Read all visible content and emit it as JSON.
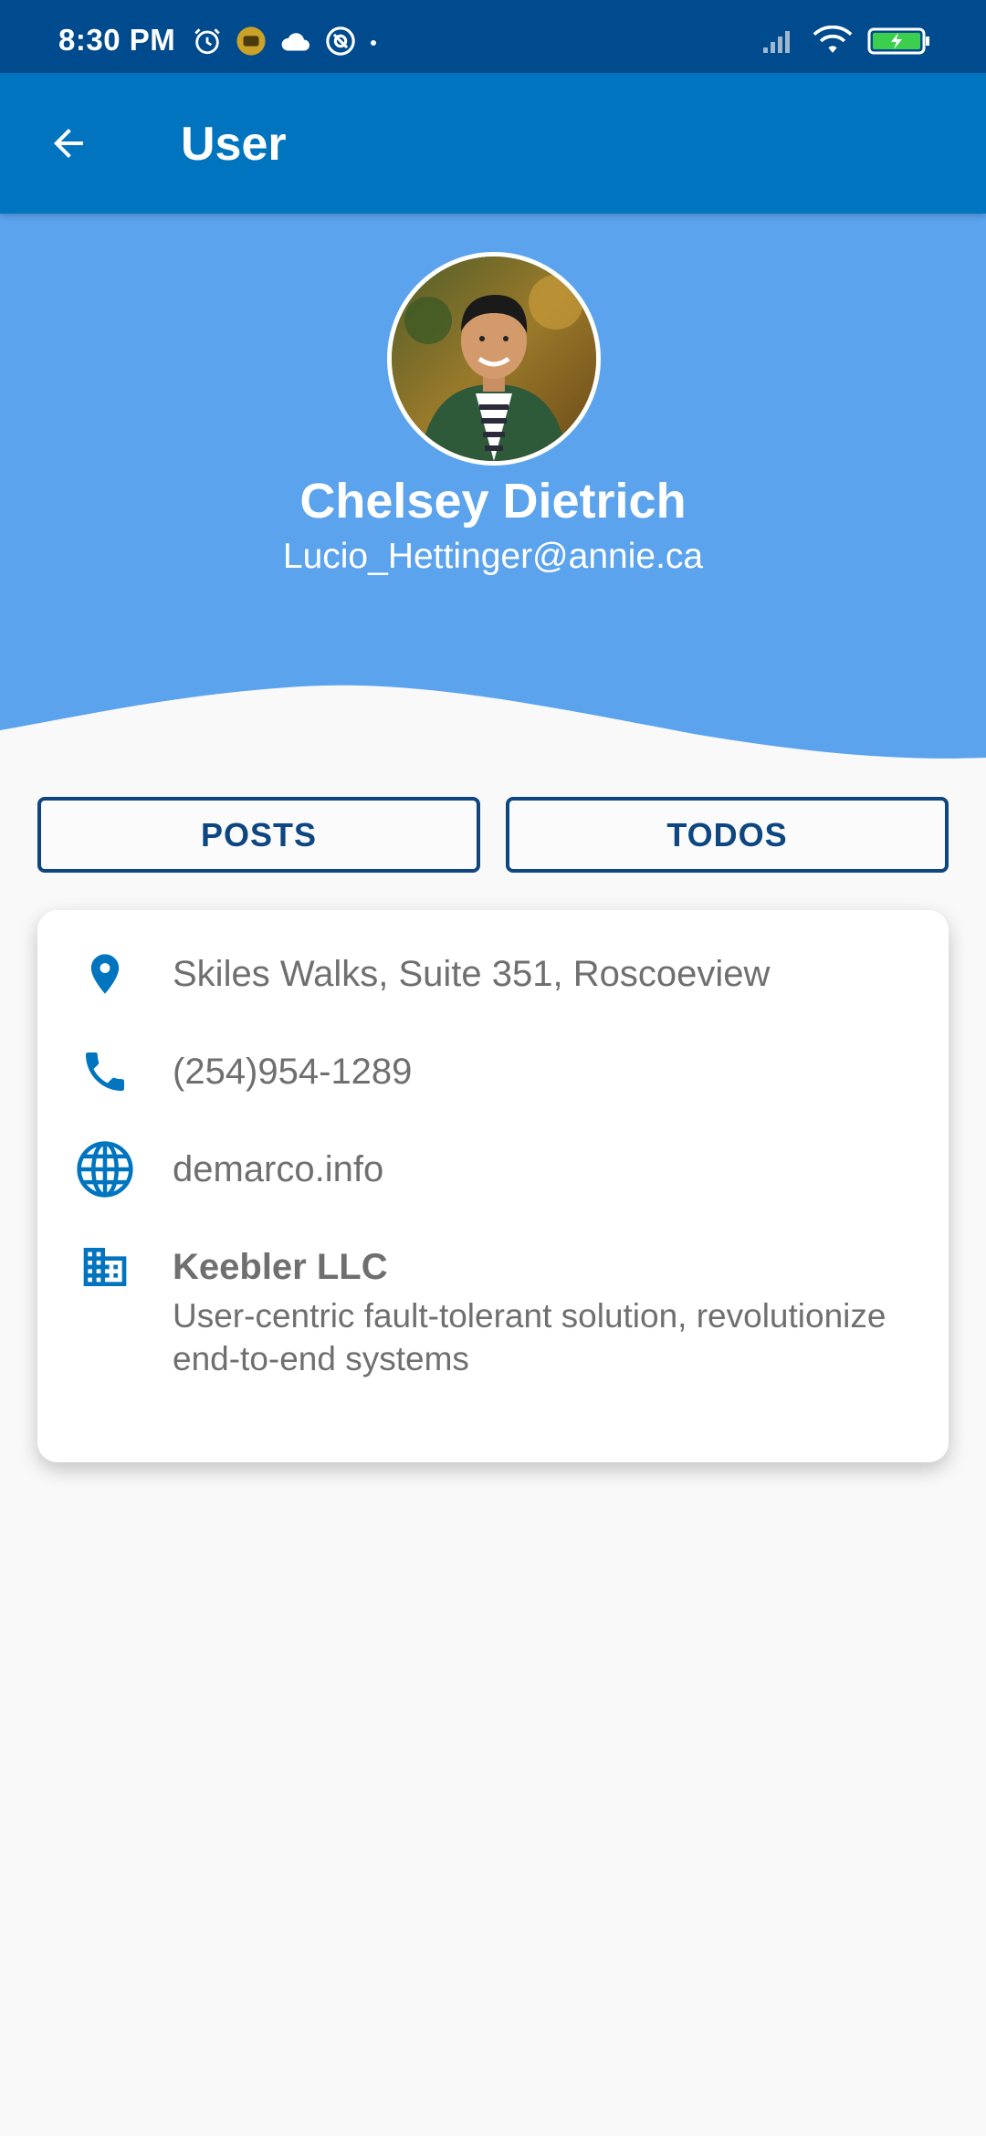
{
  "status_bar": {
    "time": "8:30 PM",
    "left_icons": [
      "alarm-icon",
      "notification-badge-icon",
      "cloud-icon",
      "at-sign-icon",
      "dot-icon"
    ],
    "right_icons": [
      "signal-icon",
      "wifi-icon",
      "battery-charging-icon"
    ]
  },
  "app_bar": {
    "title": "User",
    "back_icon": "arrow-back-icon"
  },
  "profile": {
    "name": "Chelsey Dietrich",
    "email": "Lucio_Hettinger@annie.ca",
    "avatar_icon": "avatar-photo"
  },
  "buttons": {
    "posts_label": "POSTS",
    "todos_label": "TODOS"
  },
  "details": {
    "address": "Skiles Walks, Suite 351, Roscoeview",
    "phone": "(254)954-1289",
    "website": "demarco.info",
    "company_name": "Keebler LLC",
    "company_catchphrase": "User-centric fault-tolerant solution, revolutionize end-to-end systems"
  },
  "colors": {
    "status_bar": "#004b8d",
    "app_bar": "#0174bf",
    "header": "#5ba3ed",
    "button_outline": "#0d4680",
    "icon": "#0174bf",
    "text_secondary": "#6f6f6f"
  }
}
